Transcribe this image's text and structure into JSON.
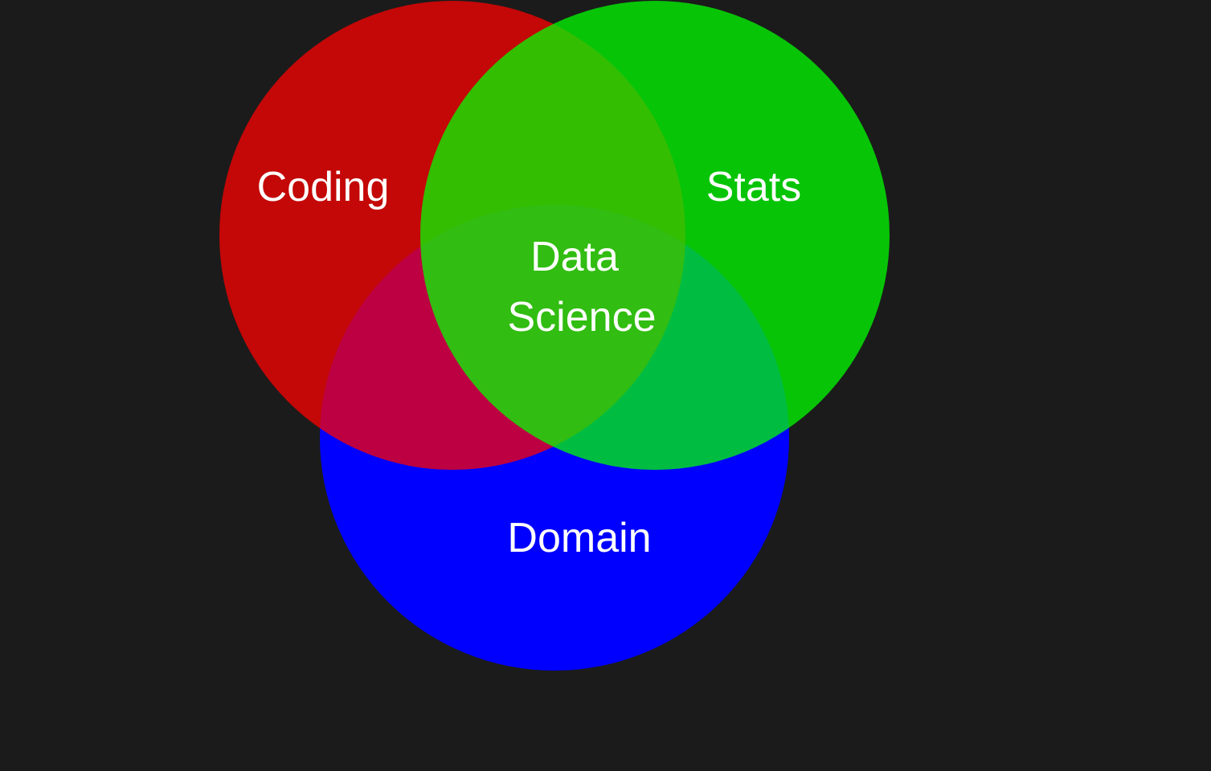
{
  "diagram": {
    "type": "venn",
    "background": "#1b1b1b",
    "sets": [
      {
        "id": "coding",
        "label": "Coding",
        "color": "#ff0000"
      },
      {
        "id": "stats",
        "label": "Stats",
        "color": "#00ff00"
      },
      {
        "id": "domain",
        "label": "Domain",
        "color": "#0000ff"
      }
    ],
    "center": {
      "line1": "Data",
      "line2": "Science"
    }
  }
}
